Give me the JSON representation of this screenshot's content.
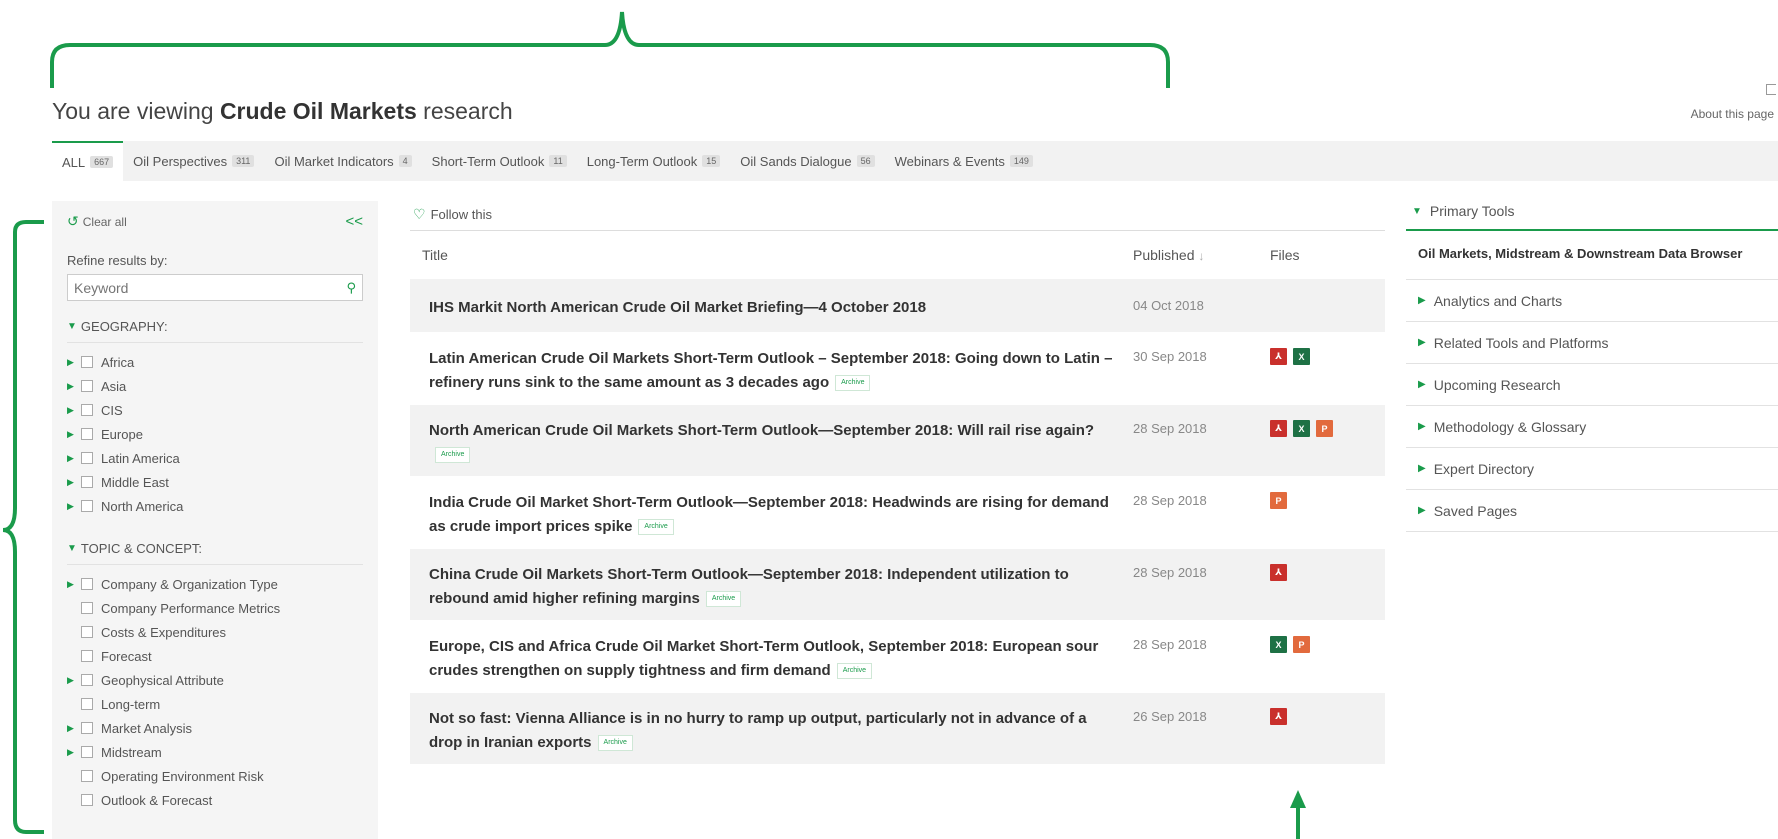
{
  "header": {
    "title_prefix": "You are viewing",
    "title_topic": "Crude Oil Markets",
    "title_suffix": "research",
    "about": "About this page"
  },
  "tabs": [
    {
      "label": "ALL",
      "count": "667"
    },
    {
      "label": "Oil Perspectives",
      "count": "311"
    },
    {
      "label": "Oil Market Indicators",
      "count": "4"
    },
    {
      "label": "Short-Term Outlook",
      "count": "11"
    },
    {
      "label": "Long-Term Outlook",
      "count": "15"
    },
    {
      "label": "Oil Sands Dialogue",
      "count": "56"
    },
    {
      "label": "Webinars & Events",
      "count": "149"
    }
  ],
  "facets": {
    "clear_all": "Clear all",
    "collapse": "<<",
    "refine_label": "Refine results by:",
    "keyword_placeholder": "Keyword",
    "geography_label": "GEOGRAPHY:",
    "geography": [
      "Africa",
      "Asia",
      "CIS",
      "Europe",
      "Latin America",
      "Middle East",
      "North America"
    ],
    "topic_label": "TOPIC & CONCEPT:",
    "topics": [
      {
        "label": "Company & Organization Type",
        "expandable": true
      },
      {
        "label": "Company Performance Metrics",
        "expandable": false
      },
      {
        "label": "Costs & Expenditures",
        "expandable": false
      },
      {
        "label": "Forecast",
        "expandable": false
      },
      {
        "label": "Geophysical Attribute",
        "expandable": true
      },
      {
        "label": "Long-term",
        "expandable": false
      },
      {
        "label": "Market Analysis",
        "expandable": true
      },
      {
        "label": "Midstream",
        "expandable": true
      },
      {
        "label": "Operating Environment Risk",
        "expandable": false
      },
      {
        "label": "Outlook & Forecast",
        "expandable": false
      }
    ]
  },
  "results": {
    "follow": "Follow this",
    "col_title": "Title",
    "col_published": "Published",
    "col_files": "Files",
    "archive_label": "Archive",
    "rows": [
      {
        "title": "IHS Markit North American Crude Oil Market Briefing—4 October 2018",
        "date": "04 Oct 2018",
        "archive": false,
        "files": []
      },
      {
        "title": "Latin American Crude Oil Markets Short-Term Outlook – September 2018: Going down to Latin – refinery runs sink to the same amount as 3 decades ago",
        "date": "30 Sep 2018",
        "archive": true,
        "files": [
          "pdf",
          "xls"
        ]
      },
      {
        "title": "North American Crude Oil Markets Short-Term Outlook—September 2018: Will rail rise again?",
        "date": "28 Sep 2018",
        "archive": true,
        "files": [
          "pdf",
          "xls",
          "ppt"
        ]
      },
      {
        "title": "India Crude Oil Market Short-Term Outlook—September 2018: Headwinds are rising for demand as crude import prices spike",
        "date": "28 Sep 2018",
        "archive": true,
        "files": [
          "ppt"
        ]
      },
      {
        "title": "China Crude Oil Markets Short-Term Outlook—September 2018: Independent utilization to rebound amid higher refining margins",
        "date": "28 Sep 2018",
        "archive": true,
        "files": [
          "pdf"
        ]
      },
      {
        "title": "Europe, CIS and Africa Crude Oil Market Short-Term Outlook, September 2018: European sour crudes strengthen on supply tightness and firm demand",
        "date": "28 Sep 2018",
        "archive": true,
        "files": [
          "xls",
          "ppt"
        ]
      },
      {
        "title": "Not so fast: Vienna Alliance is in no hurry to ramp up output, particularly not in advance of a drop in Iranian exports",
        "date": "26 Sep 2018",
        "archive": true,
        "files": [
          "pdf"
        ]
      }
    ]
  },
  "tools": {
    "head": "Primary Tools",
    "primary": "Oil Markets, Midstream & Downstream Data Browser",
    "items": [
      "Analytics and Charts",
      "Related Tools and Platforms",
      "Upcoming Research",
      "Methodology & Glossary",
      "Expert Directory",
      "Saved Pages"
    ]
  },
  "colors": {
    "accent": "#1a9b4b",
    "pdf": "#c9302c",
    "xls": "#1e7145",
    "ppt": "#e26a3d"
  },
  "icons": {
    "pdf": "pdf-icon",
    "xls": "excel-icon",
    "ppt": "powerpoint-icon"
  }
}
